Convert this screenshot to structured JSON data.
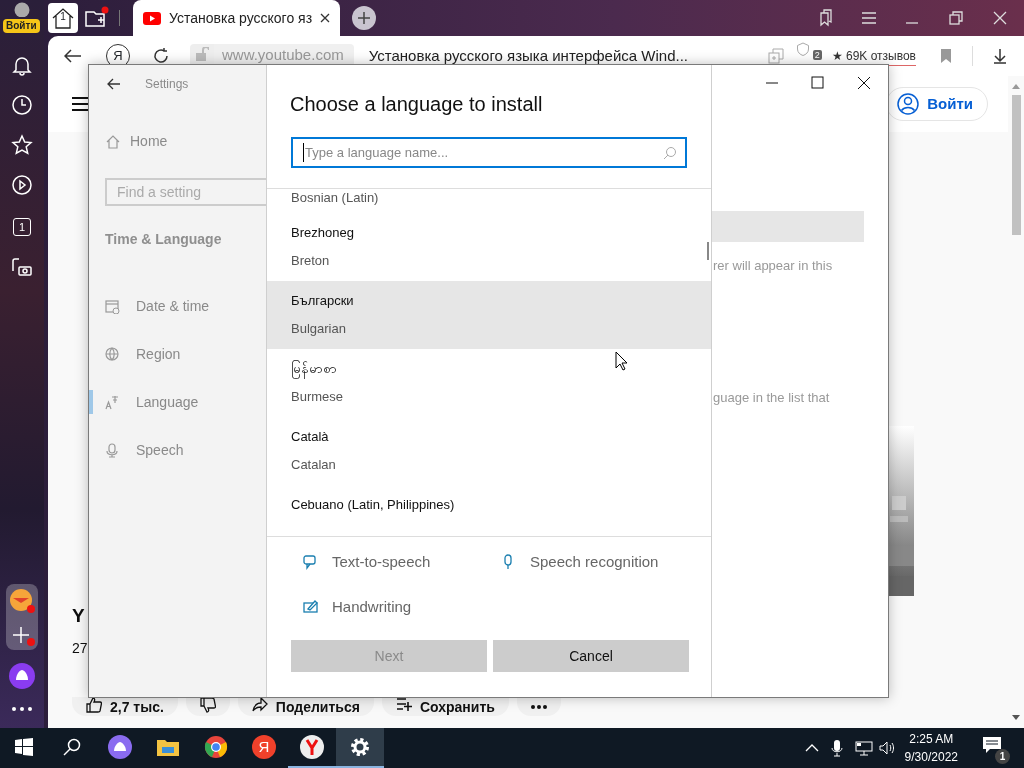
{
  "browser": {
    "login_badge": "Войти",
    "sidebar_counter": "1",
    "home_tab_counter": "1",
    "tabs": [
      {
        "title": "Установка русского яз",
        "selected": true
      }
    ],
    "address": {
      "yandex_button": "Я",
      "url": "www.youtube.com",
      "page_title": "Установка русского языка интерфейса Wind...",
      "extensions_badge": "2",
      "reviews": "★ 69K отзывов"
    }
  },
  "youtube": {
    "login_button": "Войти",
    "video_title": "Y",
    "views": "27",
    "actions": [
      {
        "kind": "like",
        "label": "2,7 тыс."
      },
      {
        "kind": "dislike"
      },
      {
        "kind": "share",
        "label": "Поделиться"
      },
      {
        "kind": "save",
        "label": "Сохранить"
      },
      {
        "kind": "more"
      }
    ]
  },
  "settings": {
    "title": "Settings",
    "home": "Home",
    "search_placeholder": "Find a setting",
    "section": "Time & Language",
    "nav": [
      {
        "label": "Date & time",
        "selected": false
      },
      {
        "label": "Region",
        "selected": false
      },
      {
        "label": "Language",
        "selected": true
      },
      {
        "label": "Speech",
        "selected": false
      }
    ],
    "content_fragments": [
      "rer will appear in this",
      "guage in the list that"
    ]
  },
  "dialog": {
    "title": "Choose a language to install",
    "search_placeholder": "Type a language name...",
    "languages": [
      {
        "english": "Bosnian (Latin)",
        "highlighted": false
      },
      {
        "native": "Brezhoneg",
        "english": "Breton",
        "highlighted": false
      },
      {
        "native": "Български",
        "english": "Bulgarian",
        "highlighted": true
      },
      {
        "native": "မြန်မာစာ",
        "english": "Burmese",
        "highlighted": false
      },
      {
        "native": "Català",
        "english": "Catalan",
        "highlighted": false
      },
      {
        "native": "Cebuano (Latin, Philippines)",
        "highlighted": false
      }
    ],
    "features": [
      {
        "kind": "tts",
        "label": "Text-to-speech"
      },
      {
        "kind": "speech",
        "label": "Speech recognition"
      },
      {
        "kind": "handwriting",
        "label": "Handwriting"
      }
    ],
    "buttons": [
      {
        "label": "Next",
        "disabled": true
      },
      {
        "label": "Cancel",
        "disabled": false
      }
    ]
  },
  "taskbar": {
    "apps": [
      {
        "kind": "alice",
        "running": false,
        "active": false
      },
      {
        "kind": "explorer",
        "running": false,
        "active": false
      },
      {
        "kind": "chrome",
        "running": false,
        "active": false
      },
      {
        "kind": "yandex",
        "label": "Я",
        "running": false,
        "active": false
      },
      {
        "kind": "ybrowser",
        "running": true,
        "active": false
      },
      {
        "kind": "settings",
        "running": true,
        "active": true
      }
    ],
    "time": "2:25 AM",
    "date": "9/30/2022",
    "notifications": "1"
  }
}
